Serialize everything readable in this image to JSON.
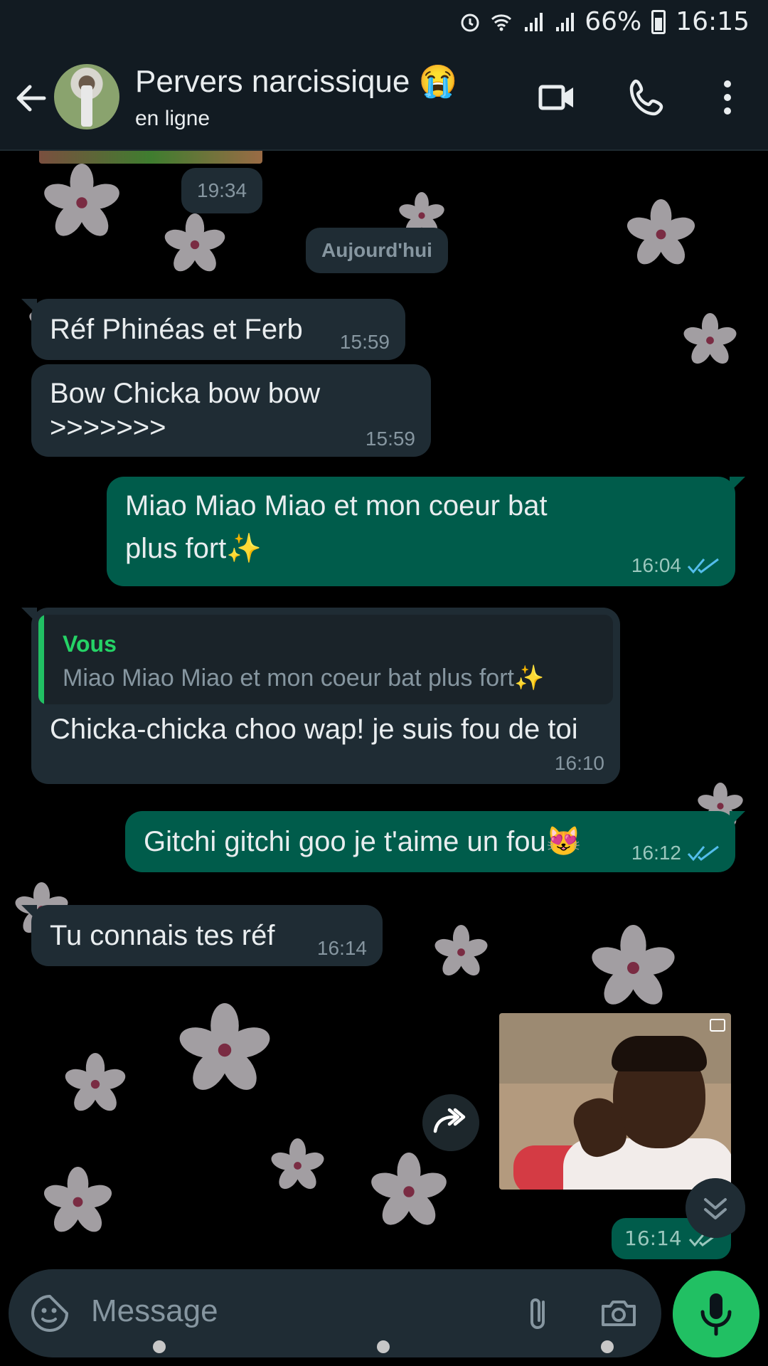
{
  "status_bar": {
    "battery": "66%",
    "time": "16:15"
  },
  "header": {
    "contact_name": "Pervers narcissique 😭",
    "contact_status": "en ligne"
  },
  "chat": {
    "previous_time": "19:34",
    "date_separator": "Aujourd'hui",
    "messages": [
      {
        "direction": "in",
        "text": "Réf Phinéas et Ferb",
        "time": "15:59"
      },
      {
        "direction": "in",
        "text_line1": "Bow Chicka bow bow",
        "text_line2": ">>>>>>>",
        "time": "15:59"
      },
      {
        "direction": "out",
        "text_line1": "Miao Miao Miao et mon coeur bat",
        "text_line2": "plus fort✨",
        "time": "16:04",
        "status": "read"
      },
      {
        "direction": "in",
        "reply_author": "Vous",
        "reply_text": "Miao Miao Miao et mon coeur bat plus fort✨",
        "text": "Chicka-chicka choo wap! je suis fou de toi",
        "time": "16:10"
      },
      {
        "direction": "out",
        "text": "Gitchi gitchi goo je t'aime un fou😻",
        "time": "16:12",
        "status": "read"
      },
      {
        "direction": "in",
        "text": "Tu connais tes réf",
        "time": "16:14"
      },
      {
        "direction": "out",
        "type": "gif",
        "time": "16:14",
        "status": "read"
      }
    ]
  },
  "composer": {
    "placeholder": "Message"
  },
  "colors": {
    "header_bg": "#121b22",
    "incoming_bubble": "#1f2c34",
    "outgoing_bubble": "#005c4b",
    "read_ticks": "#53bdeb",
    "mic_button": "#21c063"
  },
  "icons": [
    "back-arrow-icon",
    "video-call-icon",
    "phone-icon",
    "more-vert-icon",
    "emoji-sticker-icon",
    "attach-icon",
    "camera-icon",
    "mic-icon",
    "forward-icon",
    "scroll-down-icon"
  ]
}
